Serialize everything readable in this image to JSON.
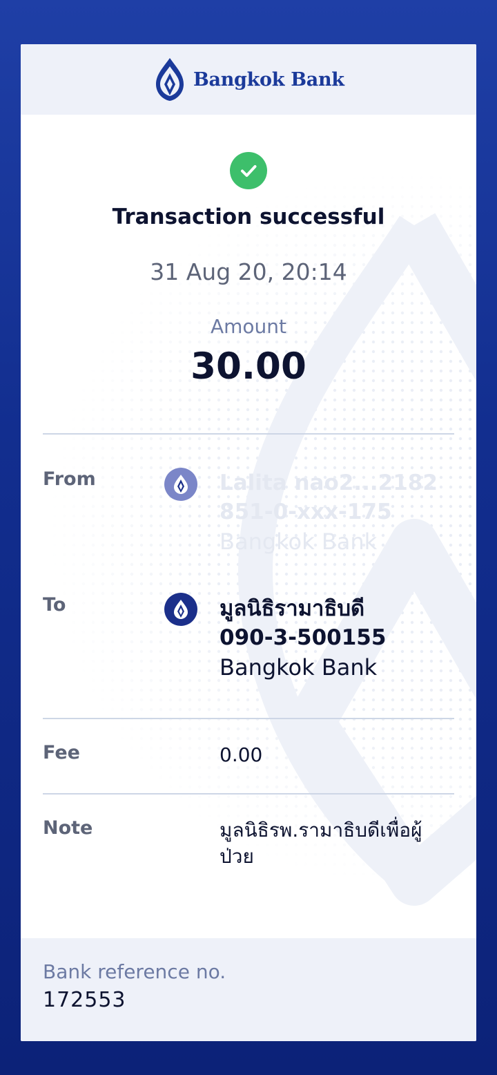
{
  "brand": {
    "name": "Bangkok Bank",
    "primary_color": "#1b3a9a",
    "success_color": "#3dbf6b"
  },
  "receipt": {
    "status": "Transaction successful",
    "datetime": "31 Aug 20, 20:14",
    "amount_label": "Amount",
    "amount": "30.00"
  },
  "from": {
    "label": "From",
    "name": "Lalita nao2...2182",
    "number": "851-0-xxx-175",
    "bank": "Bangkok Bank",
    "icon": "bangkok-bank-logo-icon"
  },
  "to": {
    "label": "To",
    "name": "มูลนิธิรามาธิบดี",
    "number": "090-3-500155",
    "bank": "Bangkok Bank",
    "icon": "bangkok-bank-logo-icon"
  },
  "fee": {
    "label": "Fee",
    "value": "0.00"
  },
  "note": {
    "label": "Note",
    "value": "มูลนิธิรพ.รามาธิบดีเพื่อผู้ป่วย"
  },
  "reference": {
    "label": "Bank reference no.",
    "value": "172553"
  }
}
